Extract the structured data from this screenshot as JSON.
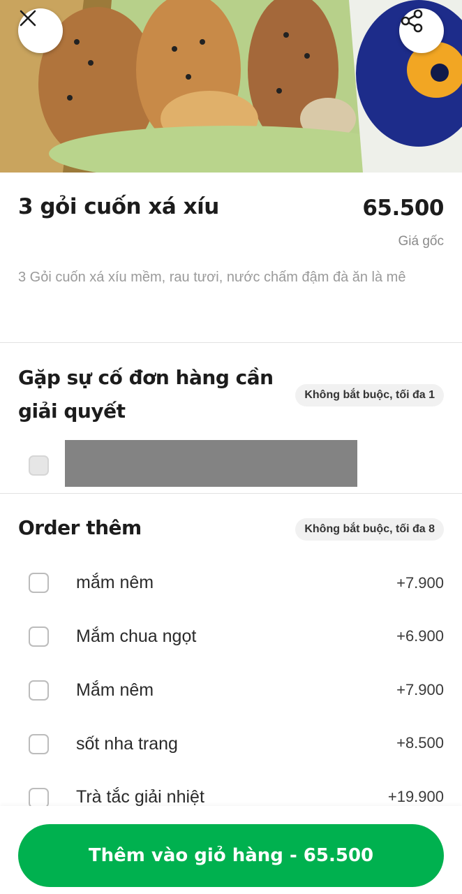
{
  "item": {
    "title": "3 gỏi cuốn xá xíu",
    "price": "65.500",
    "price_note": "Giá gốc",
    "description": "3 Gỏi cuốn xá xíu mềm, rau tươi, nước chấm đậm đà ăn là mê"
  },
  "sections": [
    {
      "title": "Gặp sự cố đơn hàng cần giải quyết",
      "badge": "Không bắt buộc, tối đa 1"
    },
    {
      "title": "Order thêm",
      "badge": "Không bắt buộc, tối đa 8",
      "options": [
        {
          "label": "mắm nêm",
          "price": "+7.900"
        },
        {
          "label": "Mắm chua ngọt",
          "price": "+6.900"
        },
        {
          "label": "Mắm nêm",
          "price": "+7.900"
        },
        {
          "label": "sốt nha trang",
          "price": "+8.500"
        },
        {
          "label": "Trà tắc giải nhiệt",
          "price": "+19.900"
        }
      ]
    }
  ],
  "cta": {
    "label": "Thêm vào giỏ hàng - 65.500"
  },
  "icons": {
    "close": "close-icon",
    "share": "share-icon"
  },
  "colors": {
    "accent": "#00b14f"
  }
}
